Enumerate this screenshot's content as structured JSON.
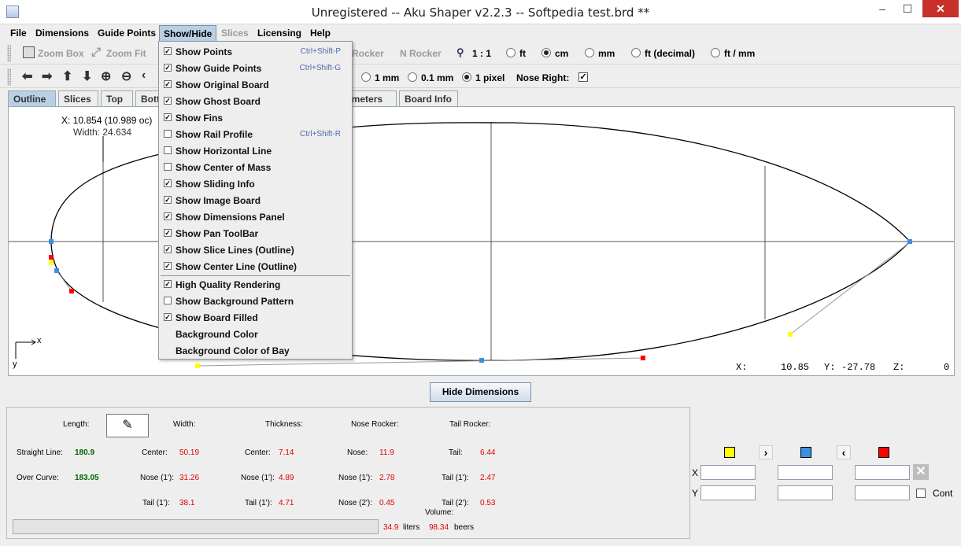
{
  "window": {
    "title": "Unregistered -- Aku Shaper v2.2.3  --  Softpedia test.brd  **"
  },
  "menubar": [
    "File",
    "Dimensions",
    "Guide Points",
    "Show/Hide",
    "Slices",
    "Licensing",
    "Help"
  ],
  "toolbar1": {
    "zoom_box": "Zoom Box",
    "zoom_fit": "Zoom Fit",
    "rocker": "Rocker",
    "n_rocker": "N Rocker",
    "scale": "1 : 1",
    "units": [
      "ft",
      "cm",
      "mm",
      "ft (decimal)",
      "ft / mm"
    ],
    "selected_unit": "cm"
  },
  "toolbar2": {
    "precision": [
      "1 mm",
      "0.1 mm",
      "1 pixel"
    ],
    "selected_precision": "1 pixel",
    "nose_right_label": "Nose Right:",
    "nose_right_checked": true
  },
  "tabs": [
    "Outline",
    "Slices",
    "Top",
    "Bott",
    "ameters",
    "Board Info"
  ],
  "canvas": {
    "readout_x": "X: 10.854 (10.989 oc)",
    "readout_width": "Width: 24.634",
    "axis_x": "x",
    "axis_y": "y",
    "status_x_label": "X:",
    "status_x": "10.85",
    "status_y_label": "Y:",
    "status_y": "-27.78",
    "status_z_label": "Z:",
    "status_z": "0"
  },
  "hide_dimensions": "Hide Dimensions",
  "dimensions": {
    "length_label": "Length:",
    "width_label": "Width:",
    "thickness_label": "Thickness:",
    "nose_rocker_label": "Nose Rocker:",
    "tail_rocker_label": "Tail Rocker:",
    "straight_line_label": "Straight Line:",
    "straight_line": "180.9",
    "over_curve_label": "Over Curve:",
    "over_curve": "183.05",
    "center_label": "Center:",
    "nose1_label": "Nose (1'):",
    "tail1_label": "Tail (1'):",
    "nose_label": "Nose:",
    "nose2_label": "Nose (2'):",
    "tail_label": "Tail:",
    "tail2_label": "Tail (2'):",
    "width_center": "50.19",
    "width_nose1": "31.26",
    "width_tail1": "38.1",
    "thick_center": "7.14",
    "thick_nose1": "4.89",
    "thick_tail1": "4.71",
    "nose_rocker_nose": "11.9",
    "nose_rocker_nose1": "2.78",
    "nose_rocker_nose2": "0.45",
    "tail_rocker_tail": "6.44",
    "tail_rocker_tail1": "2.47",
    "tail_rocker_tail2": "0.53",
    "volume_label": "Volume:",
    "volume_liters": "34.9",
    "liters_label": "liters",
    "volume_beers": "98.34",
    "beers_label": "beers"
  },
  "point_editor": {
    "x_label": "X",
    "y_label": "Y",
    "cont_label": "Cont",
    "colors": [
      "#ffff00",
      "#3d8fe0",
      "#ff0000"
    ]
  },
  "show_hide_menu": {
    "items": [
      {
        "label": "Show Points",
        "checked": true,
        "shortcut": "Ctrl+Shift-P"
      },
      {
        "label": "Show Guide Points",
        "checked": true,
        "shortcut": "Ctrl+Shift-G"
      },
      {
        "label": "Show Original Board",
        "checked": true,
        "shortcut": ""
      },
      {
        "label": "Show Ghost Board",
        "checked": true,
        "shortcut": ""
      },
      {
        "label": "Show Fins",
        "checked": true,
        "shortcut": ""
      },
      {
        "label": "Show Rail Profile",
        "checked": false,
        "shortcut": "Ctrl+Shift-R"
      },
      {
        "label": "Show Horizontal Line",
        "checked": false,
        "shortcut": ""
      },
      {
        "label": "Show Center of Mass",
        "checked": false,
        "shortcut": ""
      },
      {
        "label": "Show Sliding Info",
        "checked": true,
        "shortcut": ""
      },
      {
        "label": "Show Image Board",
        "checked": true,
        "shortcut": ""
      },
      {
        "label": "Show Dimensions Panel",
        "checked": true,
        "shortcut": ""
      },
      {
        "label": "Show Pan ToolBar",
        "checked": true,
        "shortcut": ""
      },
      {
        "label": "Show Slice Lines (Outline)",
        "checked": true,
        "shortcut": ""
      },
      {
        "label": "Show Center Line (Outline)",
        "checked": true,
        "shortcut": ""
      }
    ],
    "items2": [
      {
        "label": "High Quality Rendering",
        "checked": true
      },
      {
        "label": "Show Background Pattern",
        "checked": false
      },
      {
        "label": "Show Board Filled",
        "checked": true
      },
      {
        "label": "Background Color",
        "checked": null
      },
      {
        "label": "Background Color of Bay",
        "checked": null
      }
    ]
  }
}
